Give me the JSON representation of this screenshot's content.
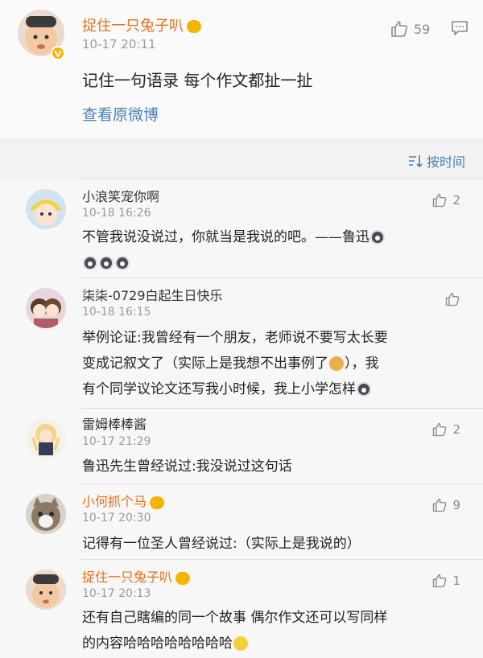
{
  "post": {
    "author": "捉住一只兔子叭",
    "time": "10-17 20:11",
    "text": "记住一句语录 每个作文都扯一扯",
    "link": "查看原微博",
    "likes": "59"
  },
  "sort": {
    "label": "按时间"
  },
  "comments": [
    {
      "author": "小浪笑宠你啊",
      "time": "10-18 16:26",
      "text_lines": [
        "不管我说没说过，你就当是我说的吧。——鲁迅"
      ],
      "likes": "2"
    },
    {
      "author": "柒柒-0729白起生日快乐",
      "time": "10-18 16:15",
      "text_lines": [
        "举例论证:我曾经有一个朋友，老师说不要写太长要",
        "变成记叙文了（实际上是我想不出事例了",
        "），我",
        "有个同学议论文还写我小时候，我上小学怎样"
      ],
      "likes": ""
    },
    {
      "author": "雷姆棒棒酱",
      "time": "10-17 21:29",
      "text_lines": [
        "鲁迅先生曾经说过:我没说过这句话"
      ],
      "likes": "2"
    },
    {
      "author": "小何抓个马",
      "time": "10-17 20:30",
      "text_lines": [
        "记得有一位圣人曾经说过:（实际上是我说的）"
      ],
      "likes": "9"
    },
    {
      "author": "捉住一只兔子叭",
      "time": "10-17 20:13",
      "text_lines": [
        "还有自己瞎编的同一个故事 偶尔作文还可以写同样",
        "的内容哈哈哈哈哈哈哈哈"
      ],
      "likes": "1"
    }
  ],
  "colors": {
    "link": "#4a7fb5",
    "vip_name": "#e96e1b",
    "meta": "#9a9a9a"
  }
}
